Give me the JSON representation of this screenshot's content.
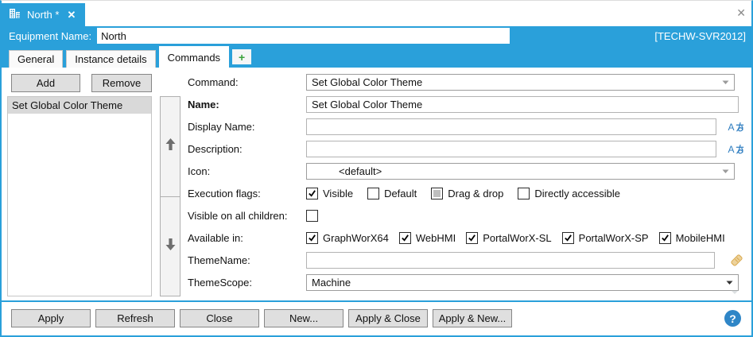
{
  "window": {
    "close_glyph": "✕",
    "host_label": "[TECHW-SVR2012]"
  },
  "doc_tab": {
    "title": "North *",
    "close_glyph": "✕",
    "icon": "equipment-building-icon"
  },
  "equipment": {
    "label": "Equipment Name:",
    "value": "North"
  },
  "tabs": [
    {
      "label": "General",
      "active": false
    },
    {
      "label": "Instance details",
      "active": false
    },
    {
      "label": "Commands",
      "active": true
    },
    {
      "label": "+",
      "active": false
    }
  ],
  "left_panel": {
    "add_label": "Add",
    "remove_label": "Remove",
    "items": [
      "Set Global Color Theme"
    ],
    "selected_index": 0
  },
  "form": {
    "command": {
      "label": "Command:",
      "value": "Set Global Color Theme"
    },
    "name": {
      "label": "Name:",
      "value": "Set Global Color Theme"
    },
    "display_name": {
      "label": "Display Name:",
      "value": "",
      "icon": "localization-icon"
    },
    "description": {
      "label": "Description:",
      "value": "",
      "icon": "localization-icon"
    },
    "icon_field": {
      "label": "Icon:",
      "value": "<default>"
    },
    "execution_flags": {
      "label": "Execution flags:",
      "options": [
        {
          "label": "Visible",
          "state": "checked"
        },
        {
          "label": "Default",
          "state": "unchecked"
        },
        {
          "label": "Drag & drop",
          "state": "indeterminate"
        },
        {
          "label": "Directly accessible",
          "state": "unchecked"
        }
      ]
    },
    "visible_all_children": {
      "label": "Visible on all children:",
      "state": "unchecked"
    },
    "available_in": {
      "label": "Available in:",
      "options": [
        {
          "label": "GraphWorX64",
          "state": "checked"
        },
        {
          "label": "WebHMI",
          "state": "checked"
        },
        {
          "label": "PortalWorX-SL",
          "state": "checked"
        },
        {
          "label": "PortalWorX-SP",
          "state": "checked"
        },
        {
          "label": "MobileHMI",
          "state": "checked"
        }
      ]
    },
    "theme_name": {
      "label": "ThemeName:",
      "value": "",
      "icon": "tag-icon"
    },
    "theme_scope": {
      "label": "ThemeScope:",
      "value": "Machine"
    }
  },
  "footer": {
    "buttons": [
      "Apply",
      "Refresh",
      "Close",
      "New...",
      "Apply & Close",
      "Apply & New..."
    ],
    "help_glyph": "?"
  },
  "colors": {
    "accent": "#2AA0DA",
    "button_bg": "#DFDFDF",
    "selected_item": "#D9D9D9",
    "localization_icon": "#2E7DC0",
    "tag_icon": "#E9C77F",
    "help_circle": "#2F86C7",
    "add_plus": "#3BA33B"
  }
}
